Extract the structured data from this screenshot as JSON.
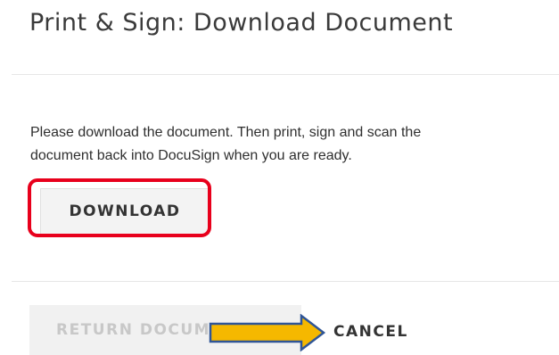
{
  "header": {
    "title": "Print & Sign: Download Document"
  },
  "body": {
    "message_line1": "Please download the document. Then print, sign and scan the",
    "message_line2": "document back into DocuSign when you are ready."
  },
  "actions": {
    "download_label": "DOWNLOAD",
    "return_label": "RETURN DOCUMENT",
    "cancel_label": "CANCEL"
  },
  "annotations": {
    "highlight_color": "#e8001c",
    "arrow_fill": "#f5b800",
    "arrow_stroke": "#2f5597"
  }
}
